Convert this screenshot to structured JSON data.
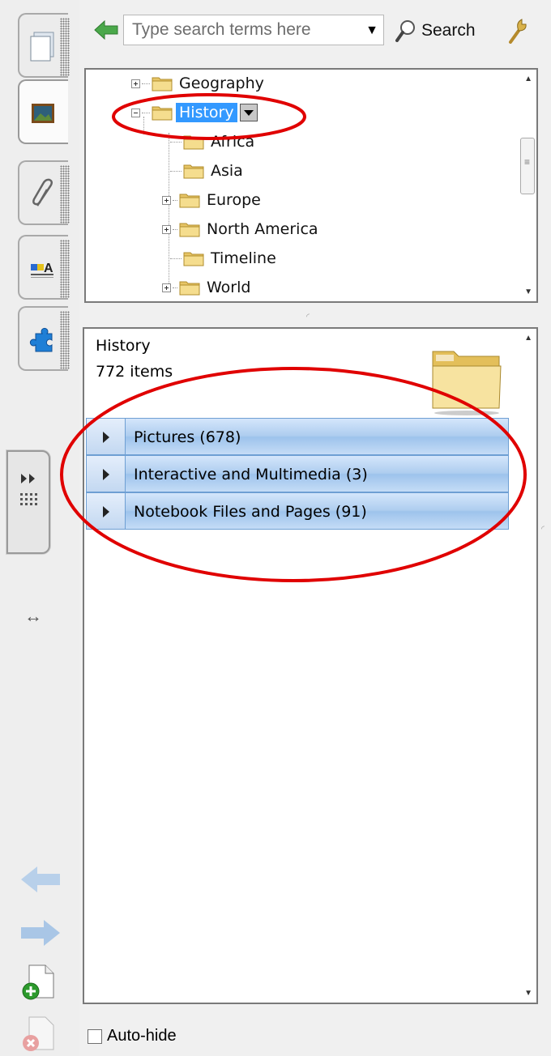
{
  "search": {
    "placeholder": "Type search terms here",
    "button_label": "Search"
  },
  "tree": {
    "items": [
      {
        "label": "Geography",
        "level": 0,
        "expandable": true,
        "expanded": false
      },
      {
        "label": "History",
        "level": 0,
        "expandable": true,
        "expanded": true,
        "selected": true
      },
      {
        "label": "Africa",
        "level": 1,
        "expandable": false
      },
      {
        "label": "Asia",
        "level": 1,
        "expandable": false
      },
      {
        "label": "Europe",
        "level": 1,
        "expandable": true,
        "expanded": false
      },
      {
        "label": "North America",
        "level": 1,
        "expandable": true,
        "expanded": false
      },
      {
        "label": "Timeline",
        "level": 1,
        "expandable": false
      },
      {
        "label": "World",
        "level": 1,
        "expandable": true,
        "expanded": false
      }
    ]
  },
  "details": {
    "title": "History",
    "count": "772 items",
    "categories": [
      {
        "label": "Pictures (678)"
      },
      {
        "label": "Interactive and Multimedia (3)"
      },
      {
        "label": "Notebook Files and Pages (91)"
      }
    ]
  },
  "footer": {
    "autohide_label": "Auto-hide",
    "autohide_checked": false
  },
  "colors": {
    "selection": "#3399ff",
    "annotation": "#e00000",
    "category_row": "#aecdef"
  }
}
